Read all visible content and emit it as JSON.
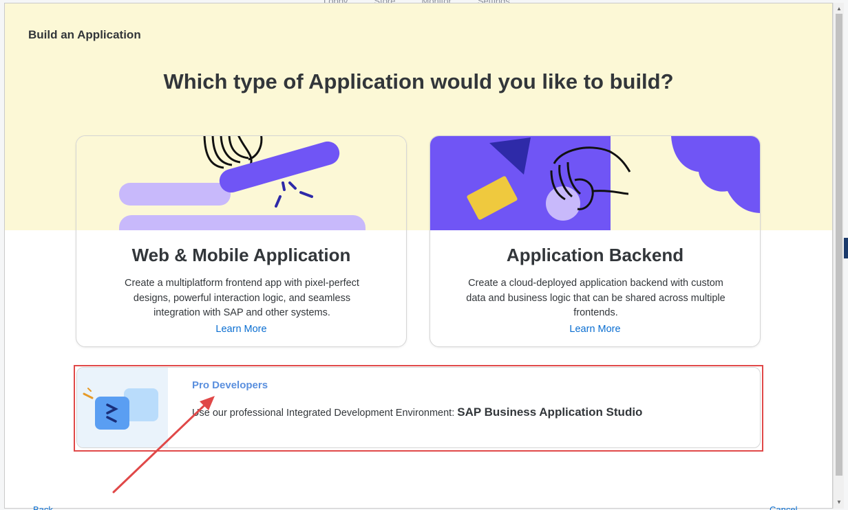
{
  "background": {
    "tabs": [
      "Lobby",
      "Store",
      "Monitor",
      "Settings"
    ]
  },
  "dialog": {
    "title": "Build an Application",
    "question": "Which type of Application would you like to build?",
    "cards": [
      {
        "title": "Web & Mobile Application",
        "description": "Create a multiplatform frontend app with pixel-perfect designs, powerful interaction logic, and seamless integration with SAP and other systems.",
        "link": "Learn More"
      },
      {
        "title": "Application Backend",
        "description": "Create a cloud-deployed application backend with custom data and business logic that can be shared across multiple frontends.",
        "link": "Learn More"
      }
    ],
    "pro": {
      "link": "Pro Developers",
      "text": "Use our professional Integrated Development Environment:",
      "strong": "SAP Business Application Studio"
    },
    "footer": {
      "left": "Back",
      "right": "Cancel"
    }
  },
  "colors": {
    "hero_bg": "#fcf8d6",
    "accent_purple": "#7055f5",
    "link_blue": "#0a6ed1",
    "pro_link": "#5a8fde",
    "highlight_red": "#e04848"
  }
}
